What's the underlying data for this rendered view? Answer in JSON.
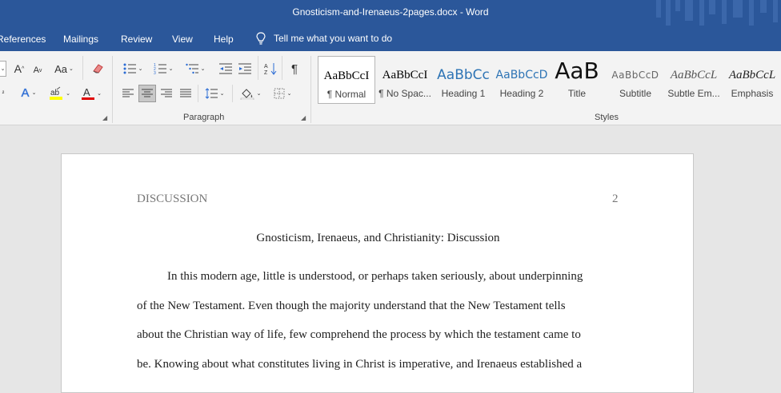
{
  "window": {
    "title": "Gnosticism-and-Irenaeus-2pages.docx  -  Word"
  },
  "tabs": [
    "References",
    "Mailings",
    "Review",
    "View",
    "Help"
  ],
  "tell_me": "Tell me what you want to do",
  "ribbon": {
    "font_size_up": "A",
    "font_size_down": "A",
    "change_case": "Aa",
    "paragraph_label": "Paragraph",
    "styles_label": "Styles",
    "styles": [
      {
        "preview": "AaBbCcI",
        "name": "¶ Normal"
      },
      {
        "preview": "AaBbCcI",
        "name": "¶ No Spac..."
      },
      {
        "preview": "AaBbCc",
        "name": "Heading 1"
      },
      {
        "preview": "AaBbCcD",
        "name": "Heading 2"
      },
      {
        "preview": "AaB",
        "name": "Title"
      },
      {
        "preview": "AaBbCcD",
        "name": "Subtitle"
      },
      {
        "preview": "AaBbCcL",
        "name": "Subtle Em..."
      },
      {
        "preview": "AaBbCcL",
        "name": "Emphasis"
      }
    ],
    "colors": {
      "highlight": "#ffff00",
      "font_color": "#e00000",
      "accent": "#2b579a"
    }
  },
  "document": {
    "header_left": "DISCUSSION",
    "header_right": "2",
    "title": "Gnosticism, Irenaeus, and Christianity: Discussion",
    "lines": [
      "In this modern age, little is understood, or perhaps taken seriously, about underpinning",
      "of the New Testament. Even though the majority understand that the New Testament tells",
      "about the Christian way of life, few comprehend the process by which the testament came to",
      "be. Knowing about what constitutes living in Christ is imperative, and Irenaeus established a"
    ]
  }
}
